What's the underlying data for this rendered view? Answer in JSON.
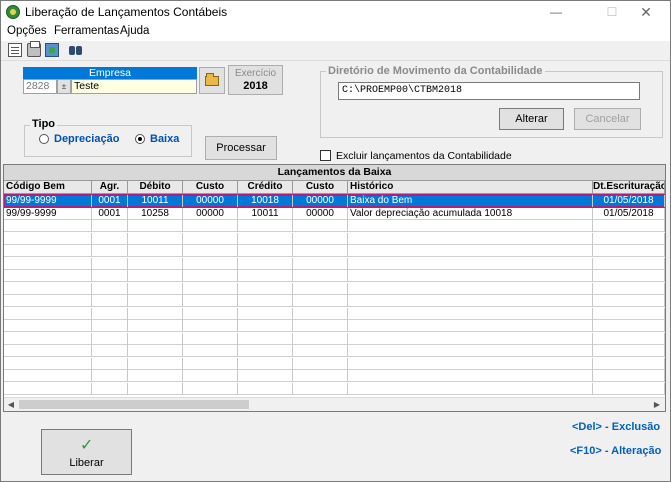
{
  "window": {
    "title": "Liberação de Lançamentos Contábeis",
    "min_glyph": "—",
    "max_glyph": "☐",
    "close_glyph": "✕"
  },
  "menu": [
    {
      "label": "Opções"
    },
    {
      "label": "Ferramentas"
    },
    {
      "label": "Ajuda"
    }
  ],
  "empresa": {
    "label": "Empresa",
    "code": "2828",
    "spin_glyph": "±",
    "name": "Teste"
  },
  "exercicio": {
    "label": "Exercício",
    "value": "2018"
  },
  "diretorio": {
    "legend": "Diretório de Movimento da Contabilidade",
    "path": "C:\\PROEMP00\\CTBM2018",
    "alterar": "Alterar",
    "cancelar": "Cancelar"
  },
  "tipo": {
    "legend": "Tipo",
    "options": [
      "Depreciação",
      "Baixa"
    ],
    "selected": "Baixa"
  },
  "processar": "Processar",
  "excluir_label": "Excluir lançamentos da Contabilidade",
  "grid": {
    "caption": "Lançamentos da Baixa",
    "columns": [
      "Código Bem",
      "Agr.",
      "Débito",
      "Custo",
      "Crédito",
      "Custo",
      "Histórico",
      "Dt.Escrituração"
    ],
    "rows": [
      [
        "99/99-9999",
        "0001",
        "10011",
        "00000",
        "10018",
        "00000",
        "Baixa do Bem",
        "01/05/2018"
      ],
      [
        "99/99-9999",
        "0001",
        "10258",
        "00000",
        "10011",
        "00000",
        "Valor depreciação acumulada 10018",
        "01/05/2018"
      ]
    ],
    "selected_row": 0
  },
  "liberar": "Liberar",
  "hints": {
    "del": "<Del> - Exclusão",
    "f10": "<F10> - Alteração"
  },
  "colors": {
    "accent": "#0078d7",
    "selection_outline": "#b0207a",
    "hint": "#0060c0"
  }
}
